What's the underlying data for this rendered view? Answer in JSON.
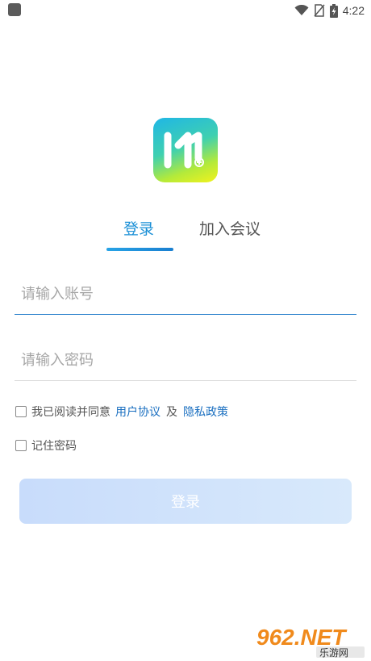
{
  "status_bar": {
    "time": "4:22",
    "icons": [
      "app-notification-icon",
      "wifi-icon",
      "no-sim-icon",
      "battery-charging-icon"
    ]
  },
  "logo": {
    "name": "app-logo-icon"
  },
  "tabs": [
    {
      "label": "登录",
      "active": true
    },
    {
      "label": "加入会议",
      "active": false
    }
  ],
  "account_field": {
    "placeholder": "请输入账号",
    "value": ""
  },
  "password_field": {
    "placeholder": "请输入密码",
    "value": ""
  },
  "agreement": {
    "prefix": "我已阅读并同意",
    "user_agreement": "用户协议",
    "conjunction": "及",
    "privacy_policy": "隐私政策",
    "checked": false
  },
  "remember_password": {
    "label": "记住密码",
    "checked": false
  },
  "login_button": {
    "label": "登录"
  },
  "watermark": {
    "text": "962.NET",
    "subtext": "乐游网"
  },
  "colors": {
    "accent": "#1a8fd6",
    "link": "#1a6fc0",
    "button_bg": "#d0e2fb"
  }
}
